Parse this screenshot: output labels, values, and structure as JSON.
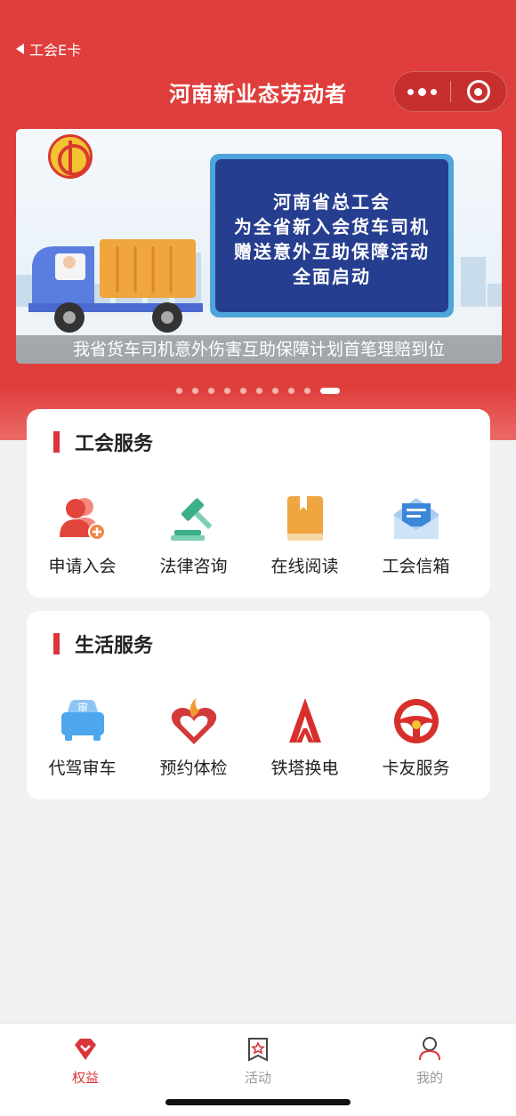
{
  "nav": {
    "back_label": "工会E卡",
    "title": "河南新业态劳动者"
  },
  "banner": {
    "board_lines": [
      "河南省总工会",
      "为全省新入会货车司机",
      "赠送意外互助保障活动",
      "全面启动"
    ],
    "caption": "我省货车司机意外伤害互助保障计划首笔理赔到位",
    "slide_count": 10,
    "active_index": 9
  },
  "union_services": {
    "title": "工会服务",
    "items": [
      {
        "label": "申请入会",
        "icon": "join-union-icon"
      },
      {
        "label": "法律咨询",
        "icon": "gavel-icon"
      },
      {
        "label": "在线阅读",
        "icon": "book-icon"
      },
      {
        "label": "工会信箱",
        "icon": "mailbox-icon"
      }
    ]
  },
  "life_services": {
    "title": "生活服务",
    "items": [
      {
        "label": "代驾审车",
        "icon": "car-inspection-icon"
      },
      {
        "label": "预约体检",
        "icon": "health-check-icon"
      },
      {
        "label": "铁塔换电",
        "icon": "tower-battery-icon"
      },
      {
        "label": "卡友服务",
        "icon": "steering-wheel-icon"
      }
    ]
  },
  "tabbar": {
    "items": [
      {
        "label": "权益",
        "icon": "diamond-icon",
        "active": true
      },
      {
        "label": "活动",
        "icon": "activity-icon",
        "active": false
      },
      {
        "label": "我的",
        "icon": "profile-icon",
        "active": false
      }
    ]
  },
  "colors": {
    "brand_red": "#df3e3c",
    "accent_red": "#d9353a",
    "board_blue": "#263e8f"
  }
}
